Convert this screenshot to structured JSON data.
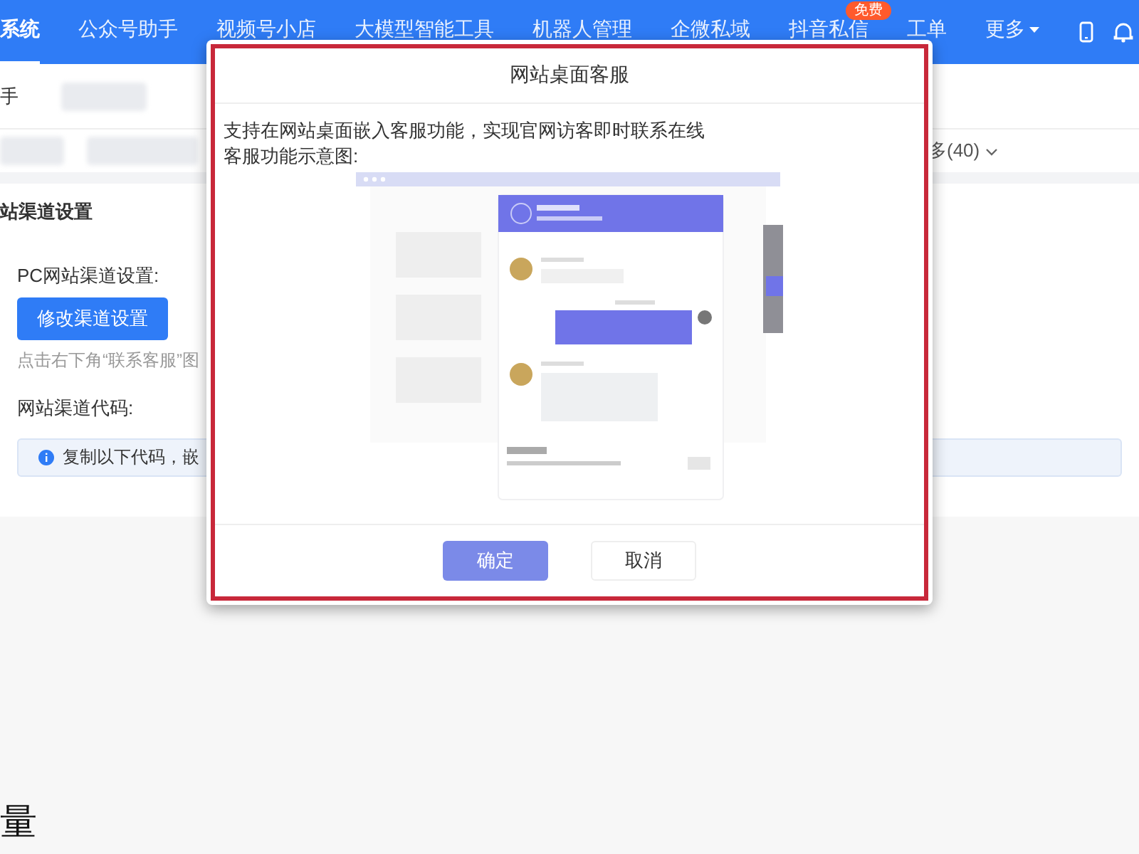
{
  "nav": {
    "items": [
      {
        "label": "系统",
        "selected": true
      },
      {
        "label": "公众号助手",
        "selected": false
      },
      {
        "label": "视频号小店",
        "selected": false
      },
      {
        "label": "大模型智能工具",
        "selected": false
      },
      {
        "label": "机器人管理",
        "selected": false
      },
      {
        "label": "企微私域",
        "selected": false
      },
      {
        "label": "抖音私信",
        "selected": false,
        "badge": "免费"
      },
      {
        "label": "工单",
        "selected": false
      },
      {
        "label": "更多",
        "selected": false,
        "dropdown": true
      }
    ]
  },
  "subtabs": [
    {
      "label": "手"
    }
  ],
  "filter": {
    "more": "多(40)"
  },
  "section": {
    "title": "站渠道设置",
    "pc_label": "PC网站渠道设置:",
    "edit_button": "修改渠道设置",
    "hint": "点击右下角“联系客服”图",
    "code_label": "网站渠道代码:",
    "info": "复制以下代码，嵌"
  },
  "footer_heading": "量",
  "dialog": {
    "title": "网站桌面客服",
    "description": "支持在网站桌面嵌入客服功能，实现官网访客即时联系在线客服功能示意图:",
    "buttons": [
      {
        "label": "确定",
        "kind": "primary"
      },
      {
        "label": "取消",
        "kind": "secondary"
      }
    ]
  }
}
